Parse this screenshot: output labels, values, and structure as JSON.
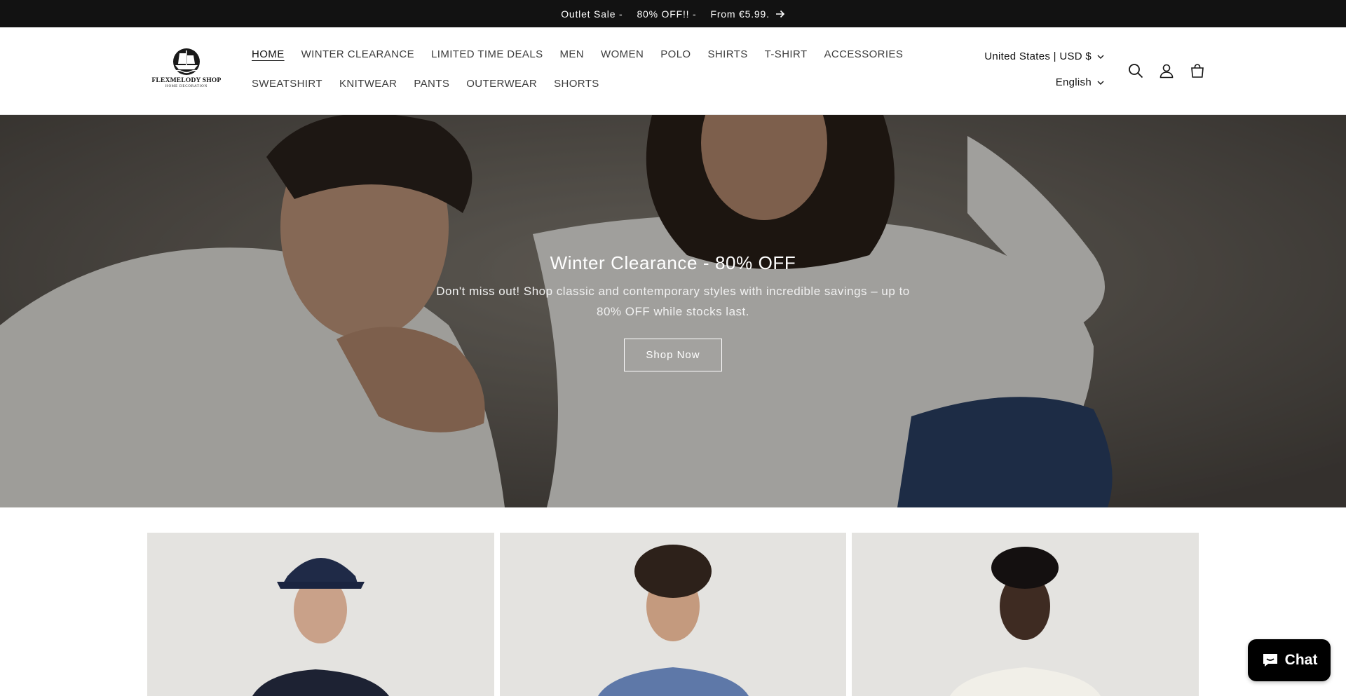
{
  "announcement": {
    "part1": "Outlet Sale -",
    "part2": "80% OFF!! -",
    "part3": "From €5.99.",
    "arrow_icon": "arrow-right-icon"
  },
  "logo": {
    "brand": "FLEXMELODY SHOP",
    "tagline": "HOME DECORATION"
  },
  "nav": {
    "row1": [
      "HOME",
      "WINTER CLEARANCE",
      "LIMITED TIME DEALS",
      "MEN",
      "WOMEN",
      "POLO",
      "SHIRTS",
      "T-SHIRT",
      "ACCESSORIES"
    ],
    "row2": [
      "SWEATSHIRT",
      "KNITWEAR",
      "PANTS",
      "OUTERWEAR",
      "SHORTS"
    ],
    "active": "HOME"
  },
  "locale": {
    "country": "United States | USD $",
    "language": "English"
  },
  "header_icons": [
    "search-icon",
    "account-icon",
    "cart-icon"
  ],
  "hero": {
    "title": "Winter Clearance - 80% OFF",
    "text": "Don't miss out! Shop classic and contemporary styles with incredible savings – up to 80% OFF while stocks last.",
    "button": "Shop Now"
  },
  "chat": {
    "label": "Chat",
    "icon": "chat-bubble-icon"
  },
  "colors": {
    "announcement_bg": "#121212",
    "chat_bg": "#000000",
    "text": "#121212"
  }
}
